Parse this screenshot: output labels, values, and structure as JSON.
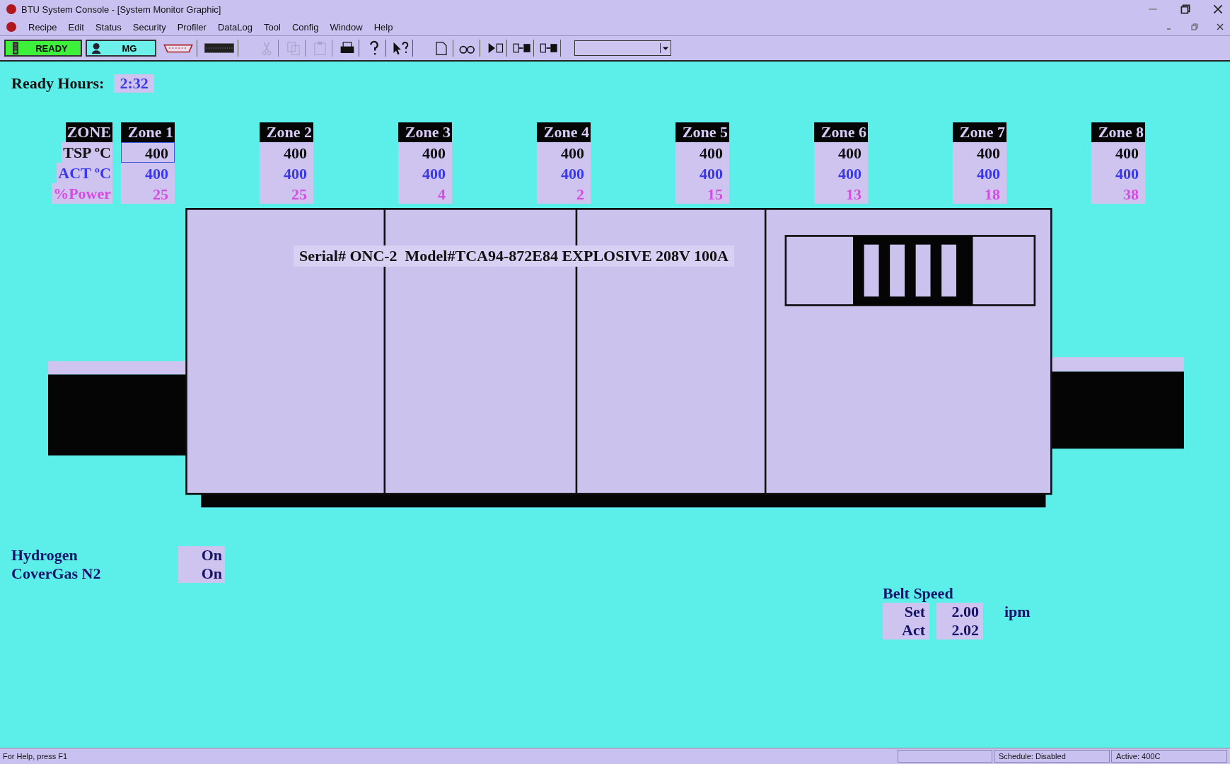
{
  "window": {
    "title": "BTU System Console - [System Monitor Graphic]"
  },
  "menu": [
    "Recipe",
    "Edit",
    "Status",
    "Security",
    "Profiler",
    "DataLog",
    "Tool",
    "Config",
    "Window",
    "Help"
  ],
  "toolbar": {
    "status_button": "READY",
    "user_button": "MG",
    "icons": [
      {
        "kind": "connector",
        "disabled": false
      },
      {
        "kind": "keyboard",
        "disabled": false
      },
      {
        "kind": "cut",
        "disabled": true
      },
      {
        "kind": "copy",
        "disabled": true
      },
      {
        "kind": "paste",
        "disabled": true
      },
      {
        "kind": "print",
        "disabled": false
      },
      {
        "kind": "help",
        "disabled": false
      },
      {
        "kind": "context-help",
        "disabled": false
      },
      {
        "kind": "new",
        "disabled": false
      },
      {
        "kind": "glasses",
        "disabled": false
      },
      {
        "kind": "run",
        "disabled": false
      },
      {
        "kind": "export",
        "disabled": false
      },
      {
        "kind": "import",
        "disabled": false
      }
    ]
  },
  "ready_hours": {
    "label": "Ready Hours:",
    "value": "2:32"
  },
  "zone_table": {
    "row_labels": [
      "ZONE",
      "TSP ºC",
      "ACT ºC",
      "%Power"
    ],
    "zones": [
      {
        "name": "Zone 1",
        "tsp": "400",
        "act": "400",
        "power": "25",
        "selected": true
      },
      {
        "name": "Zone 2",
        "tsp": "400",
        "act": "400",
        "power": "25",
        "selected": false
      },
      {
        "name": "Zone 3",
        "tsp": "400",
        "act": "400",
        "power": "4",
        "selected": false
      },
      {
        "name": "Zone 4",
        "tsp": "400",
        "act": "400",
        "power": "2",
        "selected": false
      },
      {
        "name": "Zone 5",
        "tsp": "400",
        "act": "400",
        "power": "15",
        "selected": false
      },
      {
        "name": "Zone 6",
        "tsp": "400",
        "act": "400",
        "power": "13",
        "selected": false
      },
      {
        "name": "Zone 7",
        "tsp": "400",
        "act": "400",
        "power": "18",
        "selected": false
      },
      {
        "name": "Zone 8",
        "tsp": "400",
        "act": "400",
        "power": "38",
        "selected": false
      }
    ]
  },
  "furnace": {
    "label": "Serial# ONC-2  Model#TCA94-872E84 EXPLOSIVE 208V 100A"
  },
  "gases": [
    {
      "name": "Hydrogen",
      "value": "On"
    },
    {
      "name": "CoverGas N2",
      "value": "On"
    }
  ],
  "belt_speed": {
    "title": "Belt Speed",
    "rows": [
      {
        "label": "Set",
        "value": "2.00",
        "unit": "ipm"
      },
      {
        "label": "Act",
        "value": "2.02"
      }
    ]
  },
  "status_bar": {
    "help": "For Help, press F1",
    "schedule": "Schedule: Disabled",
    "active": "Active: 400C"
  }
}
